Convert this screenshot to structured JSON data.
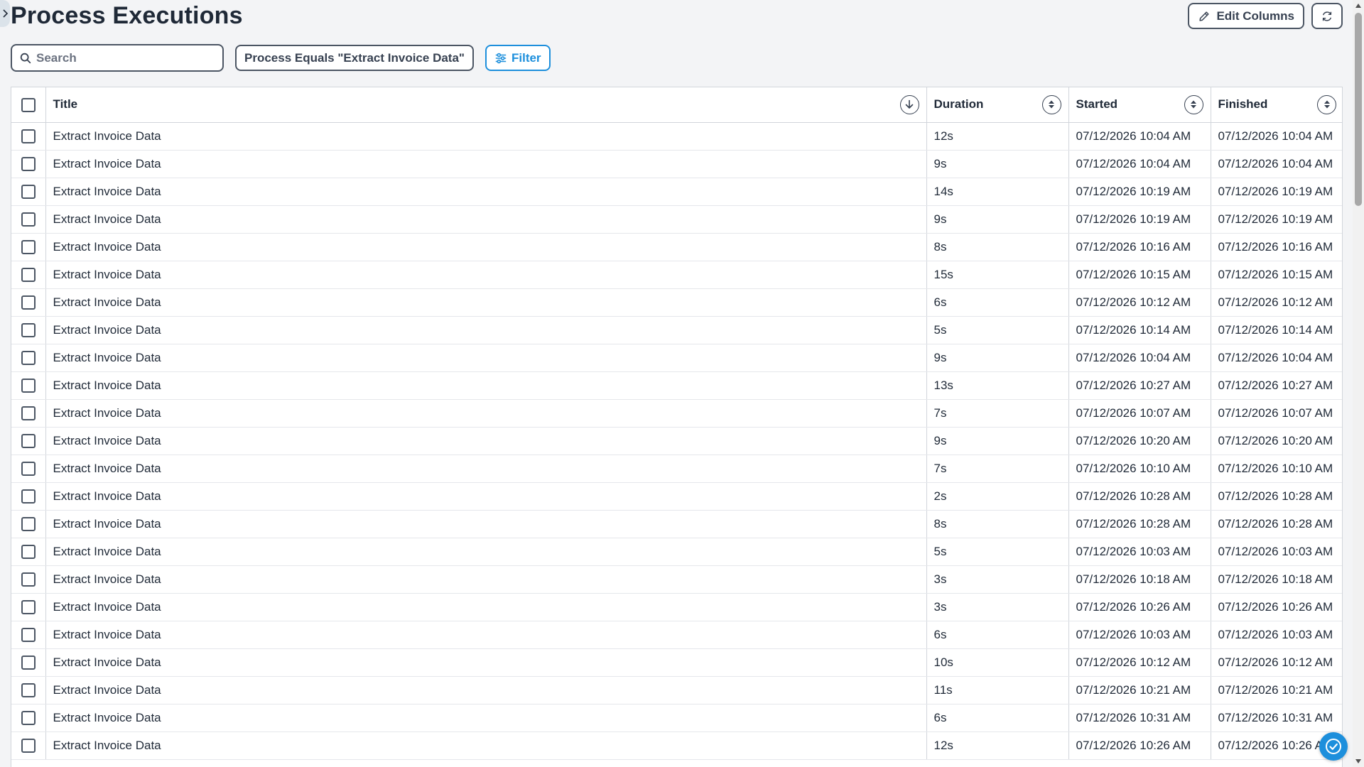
{
  "page": {
    "title": "Process Executions"
  },
  "icons": {
    "sidebar_toggle": "chevron-right-icon",
    "edit": "pencil-icon",
    "refresh": "refresh-icon",
    "search": "search-icon",
    "filter": "sliders-icon",
    "sort_active": "arrow-down-icon",
    "sort_neutral": "sort-icon",
    "fab": "check-circle-icon"
  },
  "colors": {
    "accent": "#1d8fdc",
    "border": "#4b5563",
    "background": "#f3f4f6"
  },
  "toolbar": {
    "edit_columns_label": "Edit Columns"
  },
  "filters": {
    "search_placeholder": "Search",
    "active_filter_label": "Process Equals \"Extract Invoice Data\"",
    "filter_button_label": "Filter"
  },
  "table": {
    "columns": [
      {
        "label": "Title",
        "sort": "descending"
      },
      {
        "label": "Duration",
        "sort": "none"
      },
      {
        "label": "Started",
        "sort": "none"
      },
      {
        "label": "Finished",
        "sort": "none"
      }
    ],
    "rows": [
      {
        "title": "Extract Invoice Data",
        "duration": "12s",
        "started": "07/12/2026 10:04 AM",
        "finished": "07/12/2026 10:04 AM"
      },
      {
        "title": "Extract Invoice Data",
        "duration": "9s",
        "started": "07/12/2026 10:04 AM",
        "finished": "07/12/2026 10:04 AM"
      },
      {
        "title": "Extract Invoice Data",
        "duration": "14s",
        "started": "07/12/2026 10:19 AM",
        "finished": "07/12/2026 10:19 AM"
      },
      {
        "title": "Extract Invoice Data",
        "duration": "9s",
        "started": "07/12/2026 10:19 AM",
        "finished": "07/12/2026 10:19 AM"
      },
      {
        "title": "Extract Invoice Data",
        "duration": "8s",
        "started": "07/12/2026 10:16 AM",
        "finished": "07/12/2026 10:16 AM"
      },
      {
        "title": "Extract Invoice Data",
        "duration": "15s",
        "started": "07/12/2026 10:15 AM",
        "finished": "07/12/2026 10:15 AM"
      },
      {
        "title": "Extract Invoice Data",
        "duration": "6s",
        "started": "07/12/2026 10:12 AM",
        "finished": "07/12/2026 10:12 AM"
      },
      {
        "title": "Extract Invoice Data",
        "duration": "5s",
        "started": "07/12/2026 10:14 AM",
        "finished": "07/12/2026 10:14 AM"
      },
      {
        "title": "Extract Invoice Data",
        "duration": "9s",
        "started": "07/12/2026 10:04 AM",
        "finished": "07/12/2026 10:04 AM"
      },
      {
        "title": "Extract Invoice Data",
        "duration": "13s",
        "started": "07/12/2026 10:27 AM",
        "finished": "07/12/2026 10:27 AM"
      },
      {
        "title": "Extract Invoice Data",
        "duration": "7s",
        "started": "07/12/2026 10:07 AM",
        "finished": "07/12/2026 10:07 AM"
      },
      {
        "title": "Extract Invoice Data",
        "duration": "9s",
        "started": "07/12/2026 10:20 AM",
        "finished": "07/12/2026 10:20 AM"
      },
      {
        "title": "Extract Invoice Data",
        "duration": "7s",
        "started": "07/12/2026 10:10 AM",
        "finished": "07/12/2026 10:10 AM"
      },
      {
        "title": "Extract Invoice Data",
        "duration": "2s",
        "started": "07/12/2026 10:28 AM",
        "finished": "07/12/2026 10:28 AM"
      },
      {
        "title": "Extract Invoice Data",
        "duration": "8s",
        "started": "07/12/2026 10:28 AM",
        "finished": "07/12/2026 10:28 AM"
      },
      {
        "title": "Extract Invoice Data",
        "duration": "5s",
        "started": "07/12/2026 10:03 AM",
        "finished": "07/12/2026 10:03 AM"
      },
      {
        "title": "Extract Invoice Data",
        "duration": "3s",
        "started": "07/12/2026 10:18 AM",
        "finished": "07/12/2026 10:18 AM"
      },
      {
        "title": "Extract Invoice Data",
        "duration": "3s",
        "started": "07/12/2026 10:26 AM",
        "finished": "07/12/2026 10:26 AM"
      },
      {
        "title": "Extract Invoice Data",
        "duration": "6s",
        "started": "07/12/2026 10:03 AM",
        "finished": "07/12/2026 10:03 AM"
      },
      {
        "title": "Extract Invoice Data",
        "duration": "10s",
        "started": "07/12/2026 10:12 AM",
        "finished": "07/12/2026 10:12 AM"
      },
      {
        "title": "Extract Invoice Data",
        "duration": "11s",
        "started": "07/12/2026 10:21 AM",
        "finished": "07/12/2026 10:21 AM"
      },
      {
        "title": "Extract Invoice Data",
        "duration": "6s",
        "started": "07/12/2026 10:31 AM",
        "finished": "07/12/2026 10:31 AM"
      },
      {
        "title": "Extract Invoice Data",
        "duration": "12s",
        "started": "07/12/2026 10:26 AM",
        "finished": "07/12/2026 10:26 AM"
      }
    ]
  }
}
